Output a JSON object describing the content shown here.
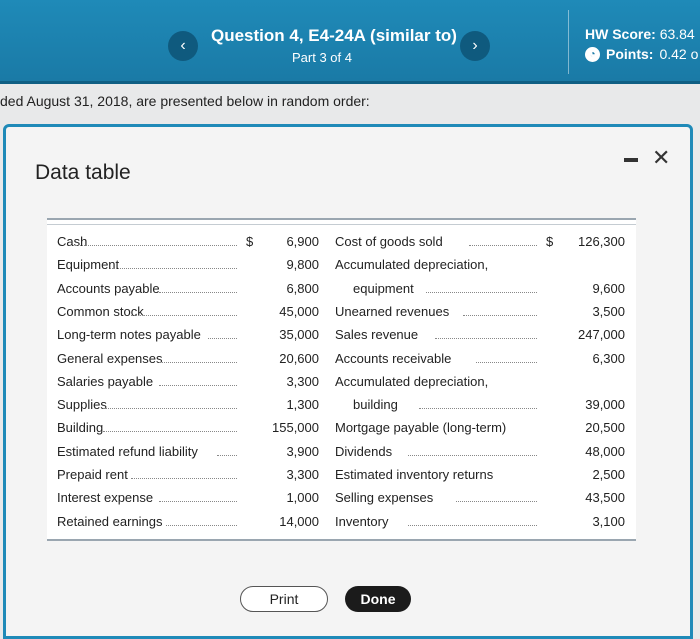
{
  "header": {
    "prev_label": "‹",
    "next_label": "›",
    "question_title": "Question 4, E4-24A (similar to)",
    "question_part": "Part 3 of 4",
    "hw_score_label": "HW Score:",
    "hw_score_value": "63.84",
    "points_label": "Points:",
    "points_value": "0.42 o"
  },
  "intro_text": "ded August 31, 2018, are presented below in random order:",
  "dialog": {
    "title": "Data table",
    "minimize_label": "",
    "close_label": "✕",
    "print_label": "Print",
    "done_label": "Done"
  },
  "table": {
    "rows": [
      {
        "left_name": "Cash",
        "left_currency": "$",
        "left_value": "6,900",
        "right_name": "Cost of goods sold",
        "right_currency": "$",
        "right_value": "126,300"
      },
      {
        "left_name": "Equipment",
        "left_currency": "",
        "left_value": "9,800",
        "right_name": "Accumulated depreciation,",
        "right_currency": "",
        "right_value": ""
      },
      {
        "left_name": "Accounts payable",
        "left_currency": "",
        "left_value": "6,800",
        "right_name": "equipment",
        "right_currency": "",
        "right_value": "9,600"
      },
      {
        "left_name": "Common stock",
        "left_currency": "",
        "left_value": "45,000",
        "right_name": "Unearned revenues",
        "right_currency": "",
        "right_value": "3,500"
      },
      {
        "left_name": "Long-term notes payable",
        "left_currency": "",
        "left_value": "35,000",
        "right_name": "Sales revenue",
        "right_currency": "",
        "right_value": "247,000"
      },
      {
        "left_name": "General expenses",
        "left_currency": "",
        "left_value": "20,600",
        "right_name": "Accounts receivable",
        "right_currency": "",
        "right_value": "6,300"
      },
      {
        "left_name": "Salaries payable",
        "left_currency": "",
        "left_value": "3,300",
        "right_name": "Accumulated depreciation,",
        "right_currency": "",
        "right_value": ""
      },
      {
        "left_name": "Supplies",
        "left_currency": "",
        "left_value": "1,300",
        "right_name": "building",
        "right_currency": "",
        "right_value": "39,000"
      },
      {
        "left_name": "Building",
        "left_currency": "",
        "left_value": "155,000",
        "right_name": "Mortgage payable (long-term)",
        "right_currency": "",
        "right_value": "20,500"
      },
      {
        "left_name": "Estimated refund liability",
        "left_currency": "",
        "left_value": "3,900",
        "right_name": "Dividends",
        "right_currency": "",
        "right_value": "48,000"
      },
      {
        "left_name": "Prepaid rent",
        "left_currency": "",
        "left_value": "3,300",
        "right_name": "Estimated inventory returns",
        "right_currency": "",
        "right_value": "2,500"
      },
      {
        "left_name": "Interest expense",
        "left_currency": "",
        "left_value": "1,000",
        "right_name": "Selling expenses",
        "right_currency": "",
        "right_value": "43,500"
      },
      {
        "left_name": "Retained earnings",
        "left_currency": "",
        "left_value": "14,000",
        "right_name": "Inventory",
        "right_currency": "",
        "right_value": "3,100"
      }
    ]
  }
}
